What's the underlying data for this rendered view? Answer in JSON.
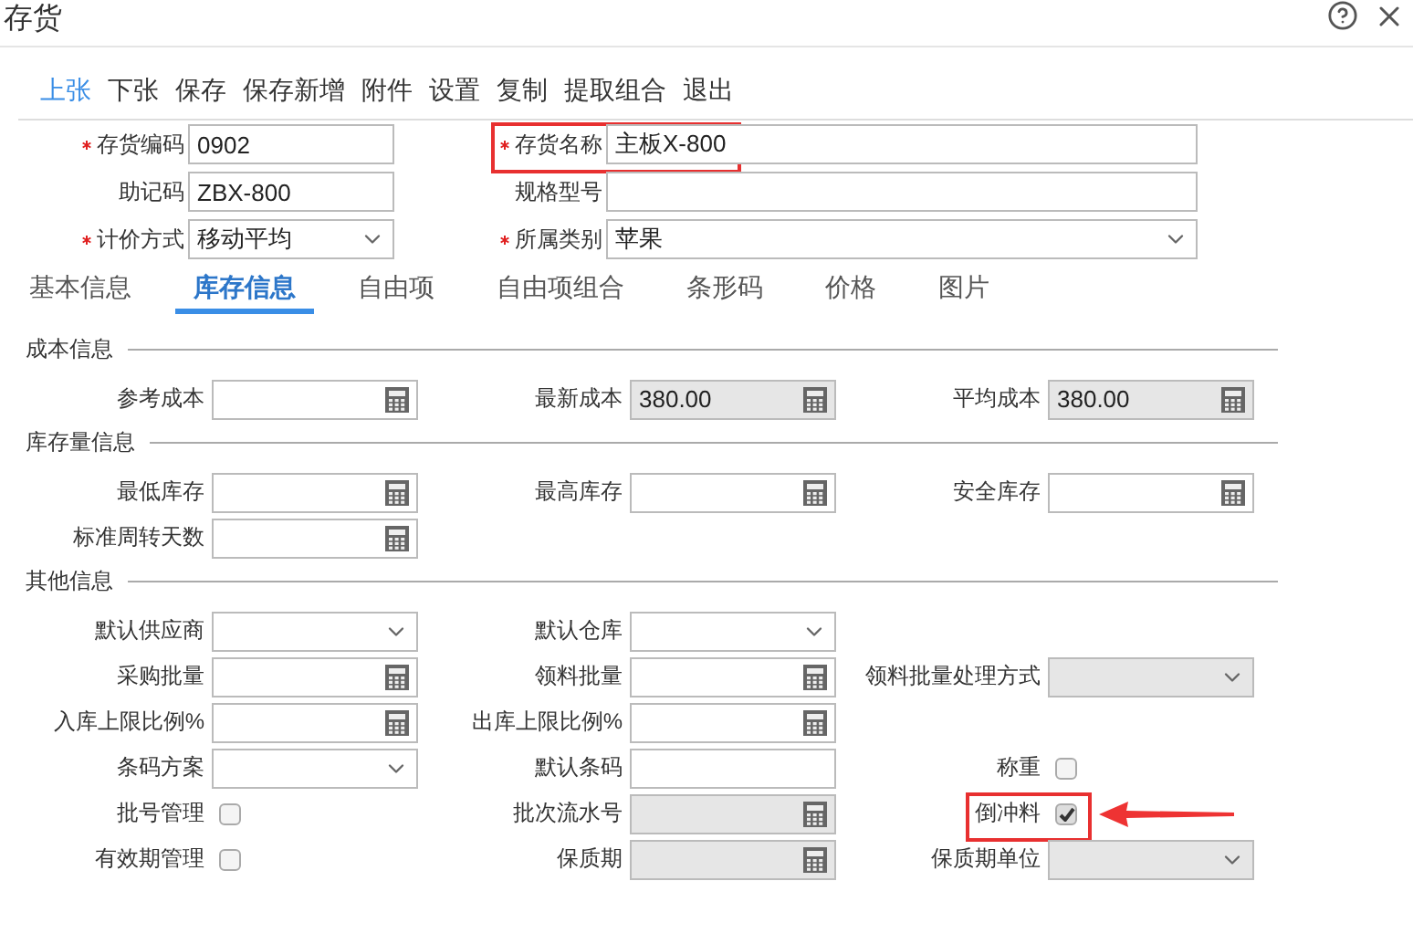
{
  "window": {
    "title": "存货"
  },
  "toolbar": [
    {
      "label": "上张",
      "selected": true
    },
    {
      "label": "下张",
      "selected": false
    },
    {
      "label": "保存",
      "selected": false
    },
    {
      "label": "保存新增",
      "selected": false
    },
    {
      "label": "附件",
      "selected": false
    },
    {
      "label": "设置",
      "selected": false
    },
    {
      "label": "复制",
      "selected": false
    },
    {
      "label": "提取组合",
      "selected": false
    },
    {
      "label": "退出",
      "selected": false
    }
  ],
  "header_fields": [
    {
      "label": "存货编码",
      "required": true,
      "kind": "text",
      "value": "0902",
      "highlighted": false
    },
    {
      "label": "存货名称",
      "required": true,
      "kind": "text",
      "value": "主板X-800",
      "highlighted": true
    },
    {
      "label": "助记码",
      "required": false,
      "kind": "text",
      "value": "ZBX-800",
      "highlighted": false
    },
    {
      "label": "规格型号",
      "required": false,
      "kind": "text",
      "highlighted": false
    },
    {
      "label": "计价方式",
      "required": true,
      "kind": "select",
      "value": "移动平均",
      "highlighted": false
    },
    {
      "label": "所属类别",
      "required": true,
      "kind": "select",
      "value": "苹果",
      "highlighted": false
    }
  ],
  "tabs": [
    {
      "label": "基本信息",
      "selected": false
    },
    {
      "label": "库存信息",
      "selected": true
    },
    {
      "label": "自由项",
      "selected": false
    },
    {
      "label": "自由项组合",
      "selected": false
    },
    {
      "label": "条形码",
      "selected": false
    },
    {
      "label": "价格",
      "selected": false
    },
    {
      "label": "图片",
      "selected": false
    }
  ],
  "sections": [
    {
      "title": "成本信息",
      "rows": [
        [
          {
            "label": "参考成本",
            "kind": "calc",
            "disabled": false
          },
          {
            "label": "最新成本",
            "kind": "calc",
            "value": "380.00",
            "disabled": true
          },
          {
            "label": "平均成本",
            "kind": "calc",
            "value": "380.00",
            "disabled": true
          }
        ]
      ]
    },
    {
      "title": "库存量信息",
      "rows": [
        [
          {
            "label": "最低库存",
            "kind": "calc",
            "disabled": false
          },
          {
            "label": "最高库存",
            "kind": "calc",
            "disabled": false
          },
          {
            "label": "安全库存",
            "kind": "calc",
            "disabled": false
          }
        ],
        [
          {
            "label": "标准周转天数",
            "kind": "calc",
            "disabled": false
          },
          null,
          null
        ]
      ]
    },
    {
      "title": "其他信息",
      "rows": [
        [
          {
            "label": "默认供应商",
            "kind": "select",
            "disabled": false
          },
          {
            "label": "默认仓库",
            "kind": "select",
            "disabled": false
          },
          null
        ],
        [
          {
            "label": "采购批量",
            "kind": "calc",
            "disabled": false
          },
          {
            "label": "领料批量",
            "kind": "calc",
            "disabled": false
          },
          {
            "label": "领料批量处理方式",
            "kind": "select",
            "disabled": true
          }
        ],
        [
          {
            "label": "入库上限比例%",
            "kind": "calc",
            "disabled": false
          },
          {
            "label": "出库上限比例%",
            "kind": "calc",
            "disabled": false
          },
          null
        ],
        [
          {
            "label": "条码方案",
            "kind": "select",
            "disabled": false
          },
          {
            "label": "默认条码",
            "kind": "text",
            "disabled": false
          },
          {
            "label": "称重",
            "kind": "checkbox",
            "checked": false,
            "highlighted": false,
            "arrow": false
          }
        ],
        [
          {
            "label": "批号管理",
            "kind": "checkbox",
            "checked": false,
            "highlighted": false,
            "arrow": false
          },
          {
            "label": "批次流水号",
            "kind": "calc",
            "disabled": true
          },
          {
            "label": "倒冲料",
            "kind": "checkbox",
            "checked": true,
            "highlighted": true,
            "arrow": true
          }
        ],
        [
          {
            "label": "有效期管理",
            "kind": "checkbox",
            "checked": false,
            "highlighted": false,
            "arrow": false
          },
          {
            "label": "保质期",
            "kind": "calc",
            "disabled": true
          },
          {
            "label": "保质期单位",
            "kind": "select",
            "disabled": true
          }
        ]
      ]
    }
  ]
}
